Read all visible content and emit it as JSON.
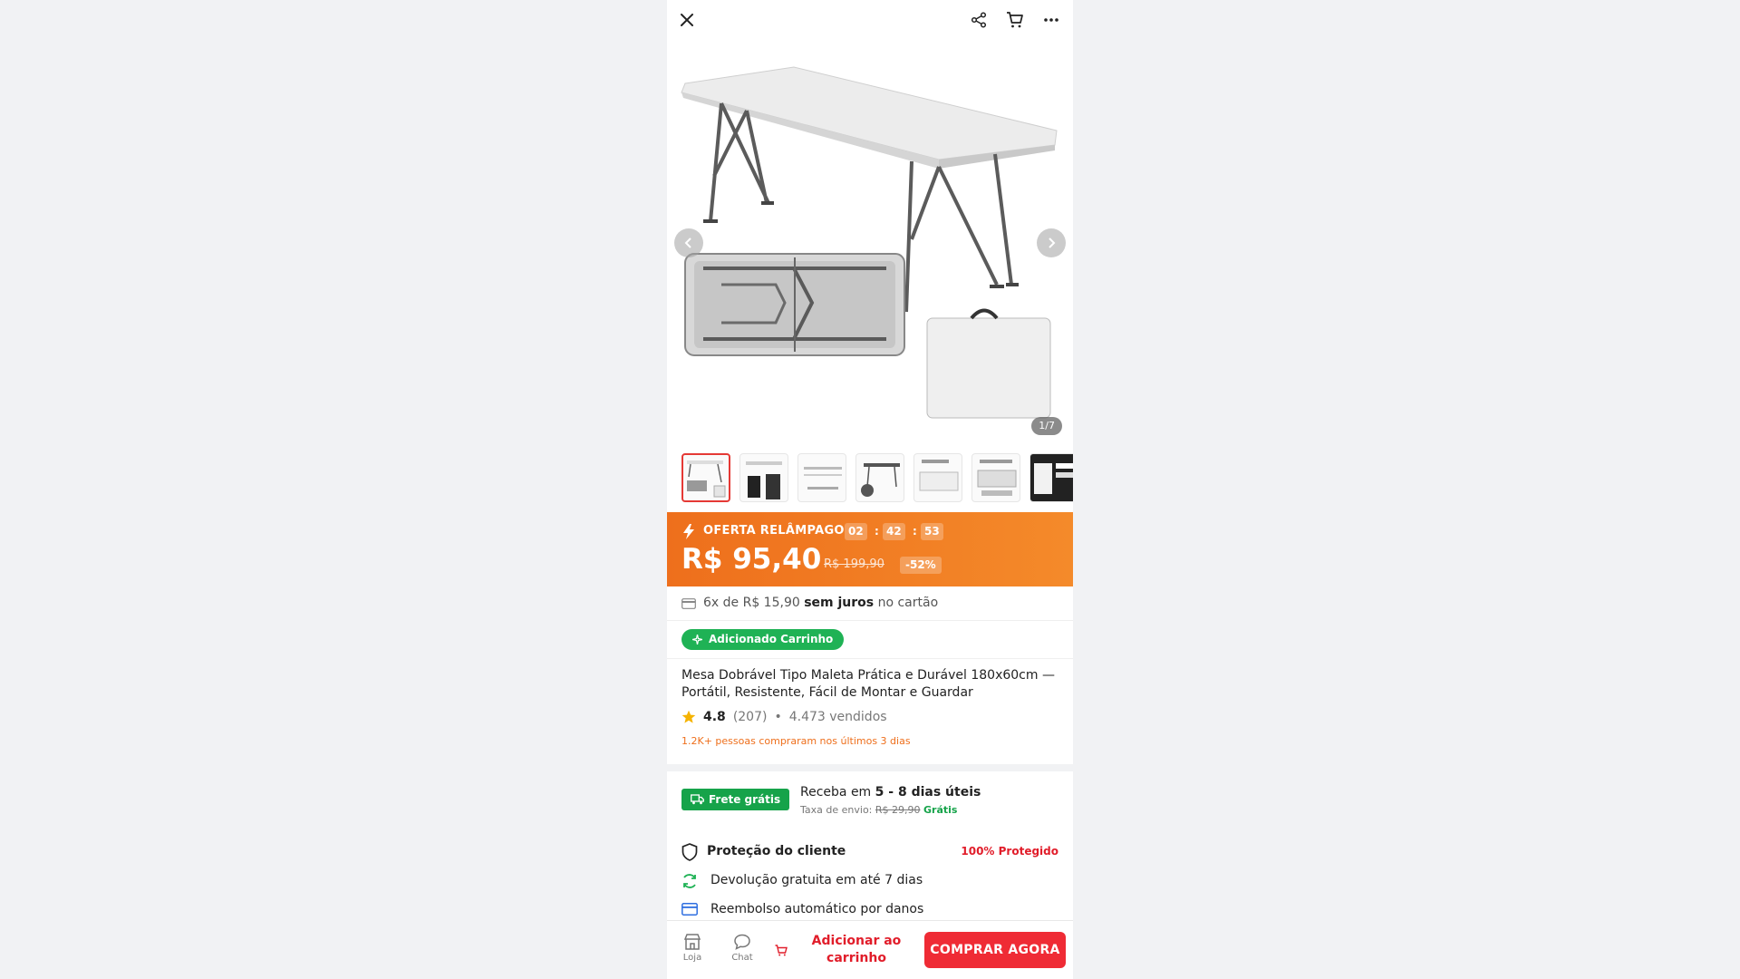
{
  "topbar": {
    "close_icon": "close-icon",
    "share_icon": "share-icon",
    "cart_icon": "cart-icon",
    "more_icon": "more-icon"
  },
  "gallery": {
    "counter": "1/7",
    "current_index": 1,
    "total_images": 7
  },
  "flash_sale": {
    "label": "OFERTA RELÂMPAGO",
    "timer": {
      "hours": "02",
      "minutes": "42",
      "seconds": "53"
    },
    "price": "R$ 95,40",
    "old_price": "R$ 199,90",
    "discount": "-52%",
    "colors": {
      "gradient_start": "#ee6f1c",
      "gradient_end": "#f48a2a"
    }
  },
  "installments": {
    "prefix": "6x de R$ 15,90",
    "bold": "sem juros",
    "suffix": "no cartão"
  },
  "cart_badge": "Adicionado Carrinho",
  "product": {
    "title": "Mesa Dobrável Tipo Maleta Prática e Durável 180x60cm — Portátil, Resistente, Fácil de Montar e Guardar",
    "rating": "4.8",
    "reviews": "(207)",
    "separator": "•",
    "sold": "4.473 vendidos",
    "social_proof": "1.2K+ pessoas compraram nos últimos 3 dias"
  },
  "shipping": {
    "badge": "Frete grátis",
    "receive_prefix": "Receba em",
    "receive_days": "5 - 8 dias úteis",
    "fee_label": "Taxa de envio:",
    "fee_old": "R$ 29,90",
    "fee_new": "Grátis"
  },
  "protection": {
    "title": "Proteção do cliente",
    "badge": "100% Protegido",
    "items": [
      "Devolução gratuita em até 7 dias",
      "Reembolso automático por danos"
    ]
  },
  "bottom_bar": {
    "store_label": "Loja",
    "chat_label": "Chat",
    "add_to_cart": "Adicionar ao carrinho",
    "buy_now": "COMPRAR AGORA"
  },
  "colors": {
    "accent_red": "#ef2b35",
    "green": "#16a34a",
    "orange": "#ee6f1c"
  }
}
